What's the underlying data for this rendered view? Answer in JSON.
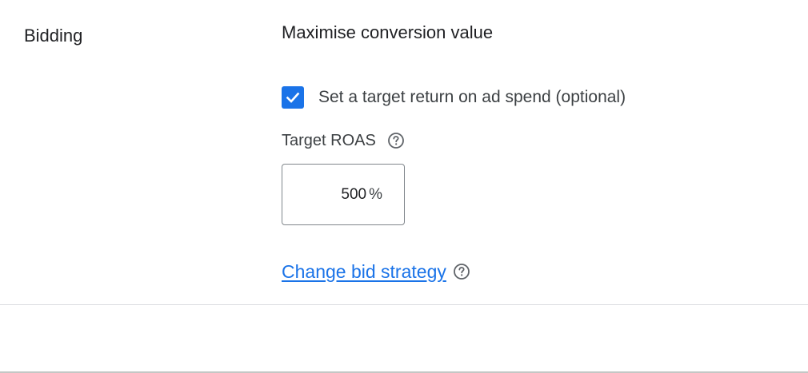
{
  "section": {
    "label": "Bidding"
  },
  "strategy": {
    "name": "Maximise conversion value"
  },
  "target_option": {
    "checked": true,
    "label": "Set a target return on ad spend (optional)"
  },
  "roas": {
    "label": "Target ROAS",
    "value": "500",
    "suffix": "%"
  },
  "change_strategy": {
    "link_text": "Change bid strategy "
  },
  "icons": {
    "checkbox": "checkmark-icon",
    "help": "help-circle-icon"
  },
  "colors": {
    "accent": "#1a73e8",
    "text_primary": "#202124",
    "text_secondary": "#3c4043",
    "border": "#80868b",
    "divider": "#dadce0"
  }
}
